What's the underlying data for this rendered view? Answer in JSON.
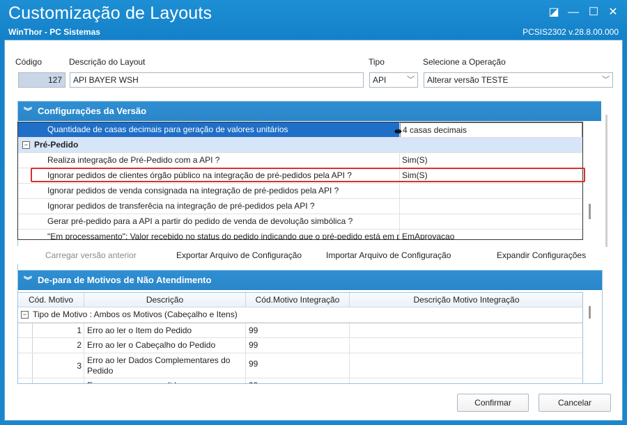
{
  "window": {
    "title": "Customização de Layouts",
    "subtitle": "WinThor - PC Sistemas",
    "version": "PCSIS2302  v.28.8.00.000",
    "controls": {
      "restore": "◪",
      "minimize": "—",
      "maximize": "☐",
      "close": "✕"
    }
  },
  "form": {
    "codigo_label": "Código",
    "codigo_value": "127",
    "descricao_label": "Descrição do Layout",
    "descricao_value": "API BAYER WSH",
    "tipo_label": "Tipo",
    "tipo_value": "API",
    "operacao_label": "Selecione a Operação",
    "operacao_value": "Alterar versão TESTE"
  },
  "config_panel": {
    "title": "Configurações da Versão",
    "rows": [
      {
        "label": "Quantidade de casas decimais para geração de valores unitários",
        "value": "4 casas decimais"
      },
      {
        "label": "Realiza integração de Pré-Pedido com a API ?",
        "value": "Sim(S)"
      },
      {
        "label": "Ignorar pedidos de clientes órgão público na integração de pré-pedidos pela API ?",
        "value": "Sim(S)"
      },
      {
        "label": "Ignorar pedidos de venda consignada na integração de pré-pedidos pela API ?",
        "value": ""
      },
      {
        "label": "Ignorar pedidos de transferêcia na integração de pré-pedidos pela API ?",
        "value": ""
      },
      {
        "label": "Gerar pré-pedido para a API a partir do pedido de venda de devolução simbólica ?",
        "value": ""
      },
      {
        "label": "\"Em processamento\": Valor recebido no status do pedido indicando que o pré-pedido está em processamento",
        "value": "EmAprovacao"
      }
    ],
    "category": "Pré-Pedido"
  },
  "toolbar": {
    "carregar": "Carregar versão anterior",
    "exportar": "Exportar Arquivo de Configuração",
    "importar": "Importar Arquivo de Configuração",
    "expandir": "Expandir Configurações"
  },
  "depara_panel": {
    "title": "De-para de Motivos de Não Atendimento",
    "columns": [
      "Cód. Motivo",
      "Descrição",
      "Cód.Motivo Integração",
      "Descrição Motivo Integração"
    ],
    "group": "Tipo de Motivo : Ambos os Motivos (Cabeçalho e Itens)",
    "rows": [
      {
        "cod": "1",
        "desc": "Erro ao ler o Item do Pedido",
        "cod_int": "99",
        "desc_int": ""
      },
      {
        "cod": "2",
        "desc": "Erro ao ler o Cabeçalho do Pedido",
        "cod_int": "99",
        "desc_int": ""
      },
      {
        "cod": "3",
        "desc": "Erro ao ler Dados Complementares do Pedido",
        "cod_int": "99",
        "desc_int": ""
      },
      {
        "cod": "",
        "desc": "Erro ao processar pedido",
        "cod_int": "99",
        "desc_int": ""
      }
    ]
  },
  "buttons": {
    "confirmar": "Confirmar",
    "cancelar": "Cancelar"
  },
  "colors": {
    "titlebar": "#1a86cb",
    "selection": "#1f6fc8",
    "category": "#d7e5f8",
    "highlight_border": "#d9302c"
  }
}
